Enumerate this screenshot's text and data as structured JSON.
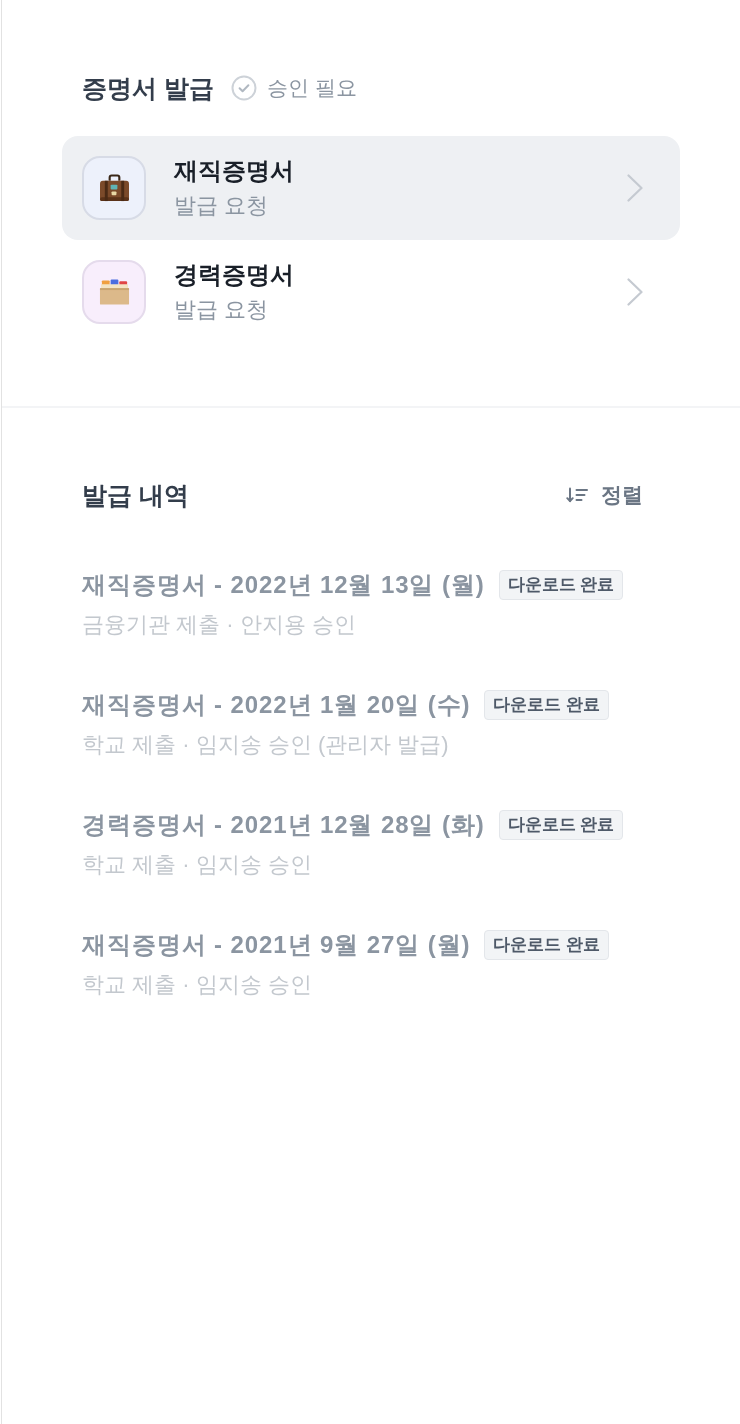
{
  "certificate_issuance": {
    "title": "증명서 발급",
    "approval_required": {
      "label": "승인 필요",
      "checked": false
    },
    "items": [
      {
        "kind": "employment",
        "title": "재직증명서",
        "subtitle": "발급 요청",
        "selected": true
      },
      {
        "kind": "career",
        "title": "경력증명서",
        "subtitle": "발급 요청",
        "selected": false
      }
    ]
  },
  "issuance_history": {
    "title": "발급 내역",
    "sort_button": "정렬",
    "entries": [
      {
        "title": "재직증명서 - 2022년 12월 13일 (월)",
        "badge": "다운로드 완료",
        "detail": "금융기관 제출 · 안지용 승인"
      },
      {
        "title": "재직증명서 - 2022년 1월 20일 (수)",
        "badge": "다운로드 완료",
        "detail": "학교 제출 · 임지송 승인 (관리자 발급)"
      },
      {
        "title": "경력증명서 - 2021년 12월 28일 (화)",
        "badge": "다운로드 완료",
        "detail": "학교 제출 · 임지송 승인"
      },
      {
        "title": "재직증명서 - 2021년 9월 27일 (월)",
        "badge": "다운로드 완료",
        "detail": "학교 제출 · 임지송 승인"
      }
    ]
  }
}
